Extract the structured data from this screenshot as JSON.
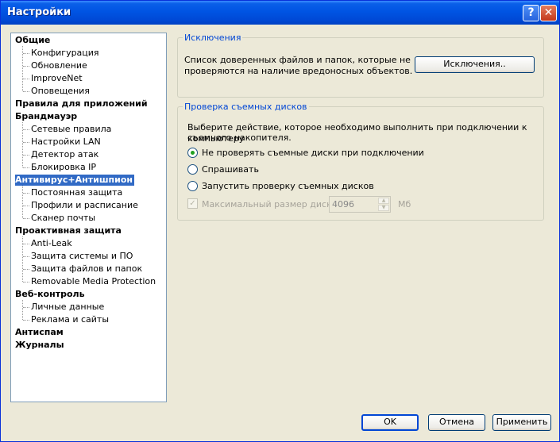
{
  "window": {
    "title": "Настройки"
  },
  "tree": {
    "categories": [
      {
        "label": "Общие",
        "items": [
          "Конфигурация",
          "Обновление",
          "ImproveNet",
          "Оповещения"
        ]
      },
      {
        "label": "Правила для приложений",
        "items": []
      },
      {
        "label": "Брандмауэр",
        "items": [
          "Сетевые правила",
          "Настройки LAN",
          "Детектор атак",
          "Блокировка IP"
        ]
      },
      {
        "label": "Антивирус+Антишпион",
        "items": [
          "Постоянная защита",
          "Профили и расписание",
          "Сканер почты"
        ]
      },
      {
        "label": "Проактивная защита",
        "items": [
          "Anti-Leak",
          "Защита системы и ПО",
          "Защита файлов и папок",
          "Removable Media Protection"
        ]
      },
      {
        "label": "Веб-контроль",
        "items": [
          "Личные данные",
          "Реклама и сайты"
        ]
      },
      {
        "label": "Антиспам",
        "items": []
      },
      {
        "label": "Журналы",
        "items": []
      }
    ],
    "selected": "Антивирус+Антишпион"
  },
  "exclusions": {
    "legend": "Исключения",
    "description_line1": "Список доверенных файлов и папок, которые не",
    "description_line2": "проверяются на наличие вредоносных объектов.",
    "button": "Исключения.."
  },
  "removable": {
    "legend": "Проверка съемных дисков",
    "description_line1": "Выберите действие, которое необходимо выполнить при подключении к компьютеру",
    "description_line2": "съемного накопителя.",
    "options": [
      "Не проверять съемные диски при подключении",
      "Спрашивать",
      "Запустить проверку съемных дисков"
    ],
    "selected_index": 0,
    "max_size_label": "Максимальный размер диска",
    "max_size_value": "4096",
    "unit": "Мб"
  },
  "buttons": {
    "ok": "OK",
    "cancel": "Отмена",
    "apply": "Применить"
  },
  "colors": {
    "selection": "#316AC5",
    "legend": "#0046D5",
    "titlebar": "#0054E3"
  }
}
